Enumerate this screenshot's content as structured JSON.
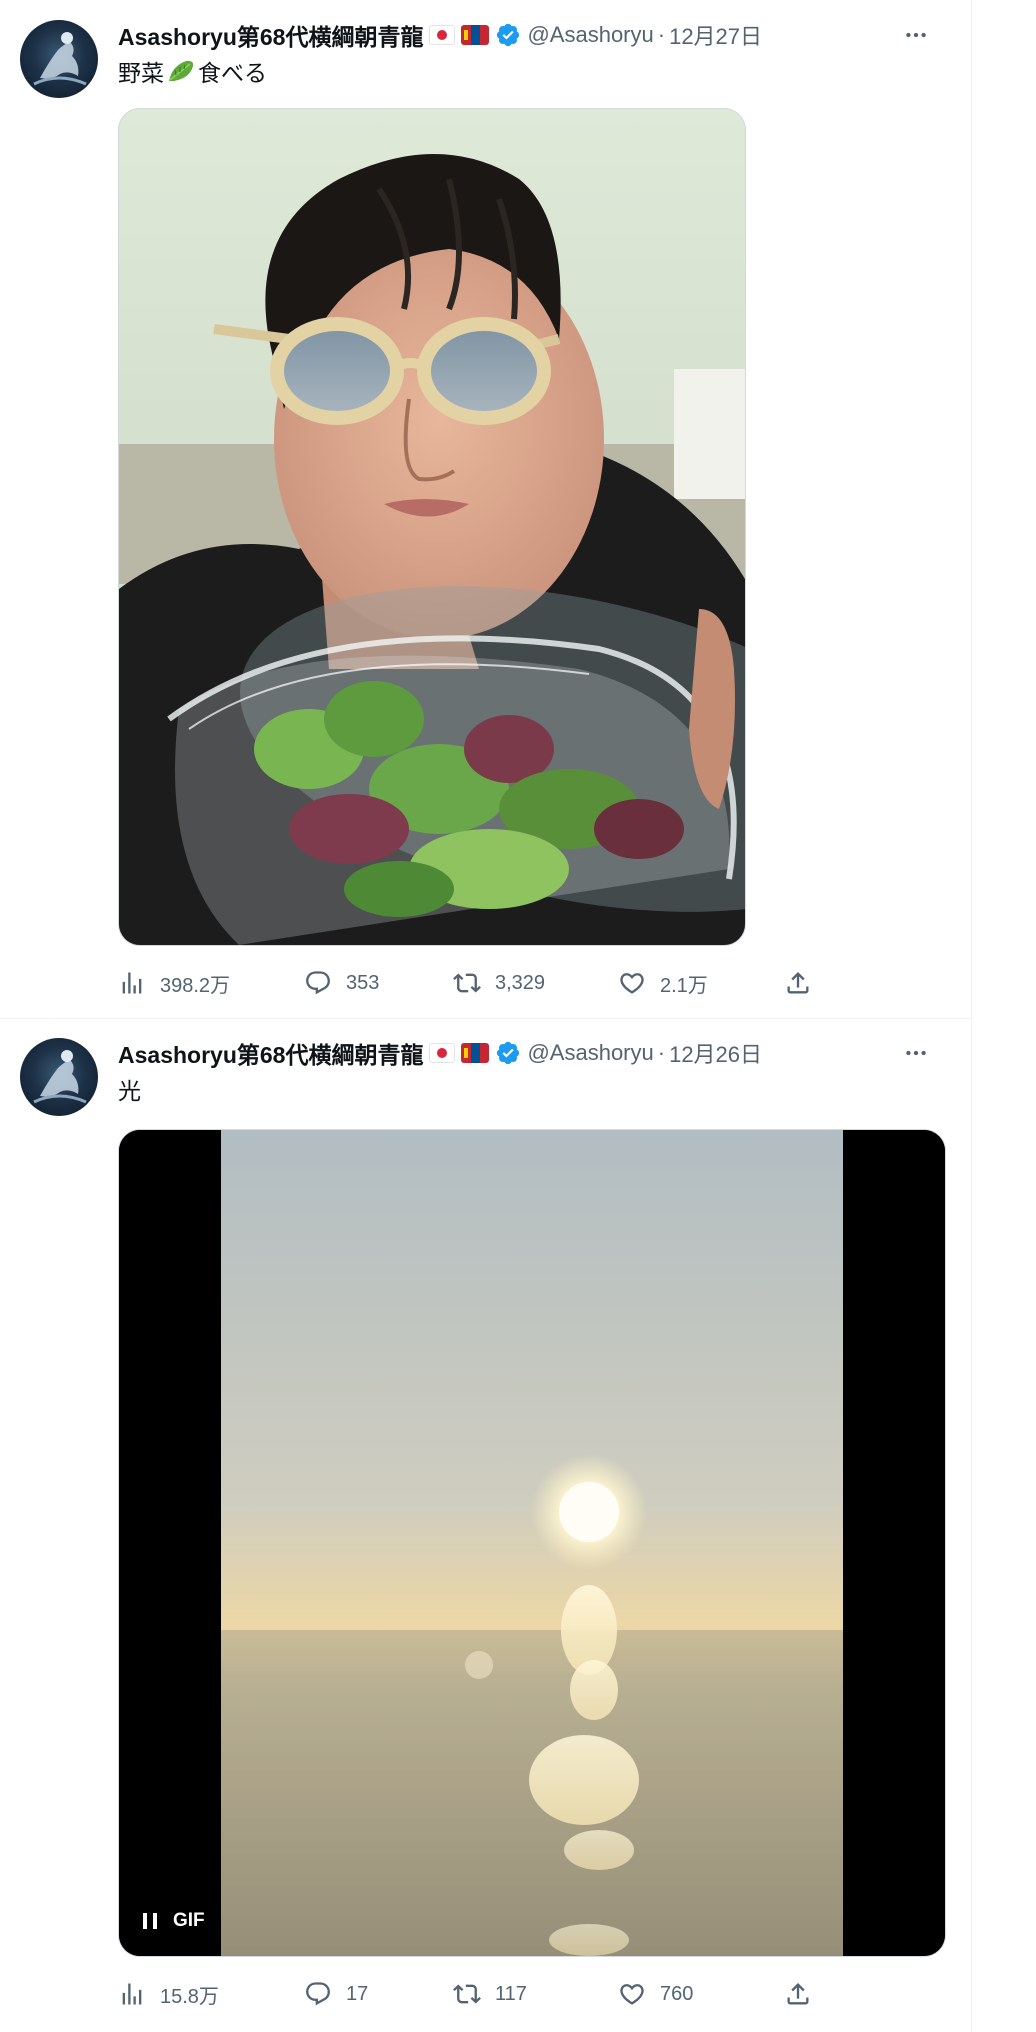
{
  "tweets": [
    {
      "author": {
        "display_name": "Asashoryu第68代横綱朝青龍",
        "flags": [
          "japan-flag",
          "mongolia-flag"
        ],
        "verified": true,
        "handle": "@Asashoryu",
        "separator": "·"
      },
      "date": "12月27日",
      "text_before": "野菜",
      "emoji": "leafy-green-emoji",
      "text_after": "食べる",
      "media": {
        "type": "photo"
      },
      "stats": {
        "views": "398.2万",
        "replies": "353",
        "retweets": "3,329",
        "likes": "2.1万"
      }
    },
    {
      "author": {
        "display_name": "Asashoryu第68代横綱朝青龍",
        "flags": [
          "japan-flag",
          "mongolia-flag"
        ],
        "verified": true,
        "handle": "@Asashoryu",
        "separator": "·"
      },
      "date": "12月26日",
      "text": "光",
      "media": {
        "type": "gif",
        "badge": "GIF"
      },
      "stats": {
        "views": "15.8万",
        "replies": "17",
        "retweets": "117",
        "likes": "760"
      }
    }
  ],
  "colors": {
    "text": "#0f1419",
    "secondary": "#536471",
    "verified": "#1d9bf0",
    "border": "#eff3f4"
  }
}
